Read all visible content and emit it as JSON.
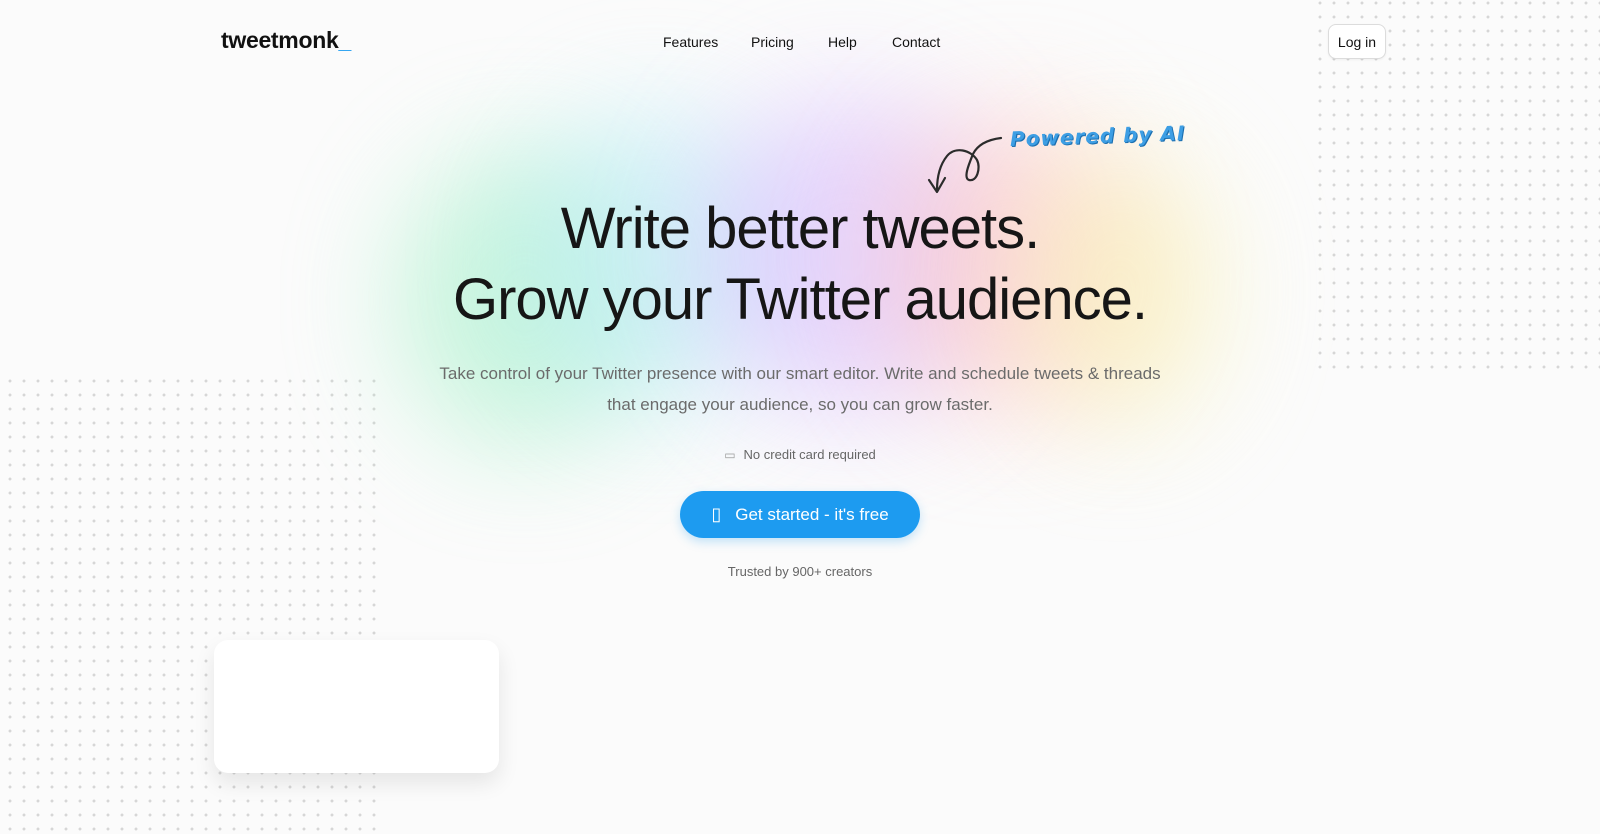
{
  "brand": {
    "name": "tweetmonk",
    "cursor": "_"
  },
  "nav": {
    "features": "Features",
    "pricing": "Pricing",
    "help": "Help",
    "contact": "Contact"
  },
  "login": "Log in",
  "tagline": "Powered by AI",
  "headline": {
    "line1": "Write better tweets.",
    "line2": "Grow your Twitter audience."
  },
  "subtitle": "Take control of your Twitter presence with our smart editor. Write and schedule tweets & threads that engage your audience, so you can grow faster.",
  "no_credit_card": "No credit card required",
  "cta": "Get started - it's free",
  "trusted": "Trusted by 900+ creators",
  "colors": {
    "accent": "#1d9bf0"
  },
  "icons": {
    "cta": "twitter-icon",
    "no_credit_card": "credit-card-icon"
  }
}
